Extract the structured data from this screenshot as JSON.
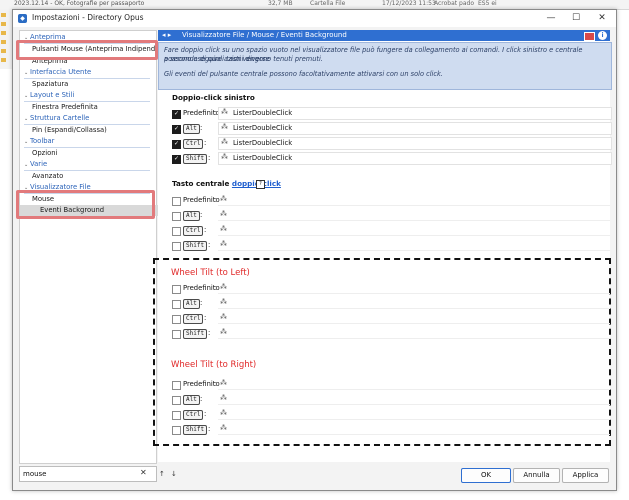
{
  "background": {
    "row_text": "2023.12.14 - OK, Fotografie per passaporto",
    "size": "32,7 MB",
    "type": "Cartella File",
    "date": "17/12/2023  11:53",
    "attr": "Acrobat pado",
    "extra": "ES5 ei"
  },
  "window": {
    "title": "Impostazioni - Directory Opus",
    "minimize": "—",
    "maximize": "☐",
    "close": "✕"
  },
  "sidebar": {
    "items": [
      {
        "label": "Anteprima",
        "kind": "cat"
      },
      {
        "label": "Pulsanti Mouse (Anteprima Indipenden...",
        "kind": "sub"
      },
      {
        "label": "Anteprima",
        "kind": "sub"
      },
      {
        "label": "Interfaccia Utente",
        "kind": "cat"
      },
      {
        "label": "Spaziatura",
        "kind": "sub"
      },
      {
        "label": "Layout e Stili",
        "kind": "cat"
      },
      {
        "label": "Finestra Predefinita",
        "kind": "sub"
      },
      {
        "label": "Struttura Cartelle",
        "kind": "cat"
      },
      {
        "label": "Pin (Espandi/Collassa)",
        "kind": "sub"
      },
      {
        "label": "Toolbar",
        "kind": "cat"
      },
      {
        "label": "Opzioni",
        "kind": "sub"
      },
      {
        "label": "Varie",
        "kind": "cat"
      },
      {
        "label": "Avanzato",
        "kind": "sub"
      },
      {
        "label": "Visualizzatore File",
        "kind": "cat"
      },
      {
        "label": "Mouse",
        "kind": "sub"
      },
      {
        "label": "Eventi Background",
        "kind": "sub2"
      }
    ],
    "search_value": "mouse",
    "search_clear": "✕"
  },
  "breadcrumb": {
    "arrows": "◂  ▸",
    "text": "Visualizzatore File / Mouse / Eventi Background",
    "info": "i"
  },
  "info": {
    "line1": "Fare doppio click su uno spazio vuoto nel visualizzatore file può fungere da collegamento ai comandi. I click sinistro e centrale possono eseguire azioni diverse",
    "line2": "a seconda di quali tasti vengono tenuti premuti.",
    "line3": "Gli eventi del pulsante centrale possono facoltativamente attivarsi con un solo click."
  },
  "double_click": {
    "title": "Doppio-click sinistro",
    "rows": [
      {
        "label": "Predefinito",
        "key": false,
        "checked": true,
        "value": "ListerDoubleClick"
      },
      {
        "label": "Alt",
        "key": true,
        "checked": true,
        "value": "ListerDoubleClick"
      },
      {
        "label": "Ctrl",
        "key": true,
        "checked": true,
        "value": "ListerDoubleClick"
      },
      {
        "label": "Shift",
        "key": true,
        "checked": true,
        "value": "ListerDoubleClick"
      }
    ]
  },
  "middle": {
    "title_prefix": "Tasto centrale",
    "title_link": "doppio-click",
    "help": "?",
    "rows": [
      {
        "label": "Predefinito",
        "key": false
      },
      {
        "label": "Alt",
        "key": true
      },
      {
        "label": "Ctrl",
        "key": true
      },
      {
        "label": "Shift",
        "key": true
      }
    ]
  },
  "tilt_left": {
    "title": "Wheel Tilt (to Left)",
    "rows": [
      {
        "label": "Predefinito",
        "key": false
      },
      {
        "label": "Alt",
        "key": true
      },
      {
        "label": "Ctrl",
        "key": true
      },
      {
        "label": "Shift",
        "key": true
      }
    ]
  },
  "tilt_right": {
    "title": "Wheel Tilt (to Right)",
    "rows": [
      {
        "label": "Predefinito",
        "key": false
      },
      {
        "label": "Alt",
        "key": true
      },
      {
        "label": "Ctrl",
        "key": true
      },
      {
        "label": "Shift",
        "key": true
      }
    ]
  },
  "colon": ":",
  "field_icon": "⁂",
  "footer": {
    "up": "↑",
    "down": "↓",
    "ok": "OK",
    "cancel": "Annulla",
    "apply": "Applica"
  },
  "colors": {
    "accent": "#2f6fd1",
    "highlight": "#e27a7c",
    "red_title": "#e02828"
  }
}
